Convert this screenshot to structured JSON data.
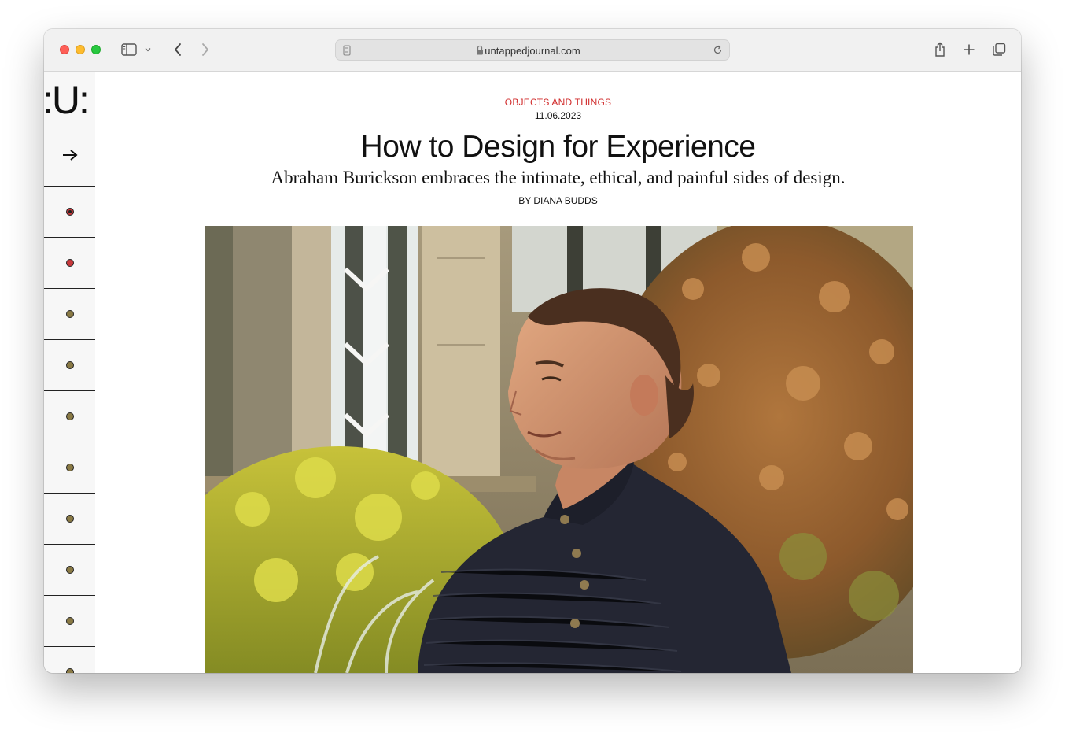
{
  "browser": {
    "url": "untappedjournal.com"
  },
  "site": {
    "logo": ":U:",
    "menu_arrow": "→"
  },
  "sidebar_dots": [
    {
      "color": "#c8383b",
      "active": true
    },
    {
      "color": "#c8383b",
      "active": false
    },
    {
      "color": "#8a7a45",
      "active": false
    },
    {
      "color": "#8a7a45",
      "active": false
    },
    {
      "color": "#8a7a45",
      "active": false
    },
    {
      "color": "#8a7a45",
      "active": false
    },
    {
      "color": "#8a7a45",
      "active": false
    },
    {
      "color": "#8a7a45",
      "active": false
    },
    {
      "color": "#8a7a45",
      "active": false
    },
    {
      "color": "#8a7a45",
      "active": false
    }
  ],
  "article": {
    "category": "OBJECTS AND THINGS",
    "date": "11.06.2023",
    "title": "How to Design for Experience",
    "dek": "Abraham Burickson embraces the intimate, ethical, and painful sides of design.",
    "byline": "BY DIANA BUDDS"
  },
  "colors": {
    "accent": "#d02a2a"
  }
}
